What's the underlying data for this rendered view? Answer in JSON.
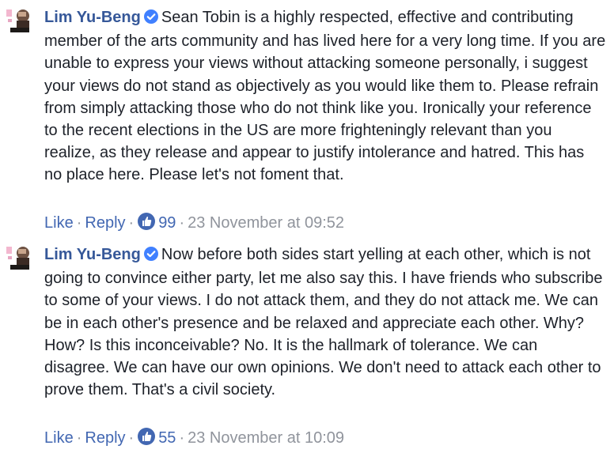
{
  "comments": [
    {
      "author": "Lim Yu-Beng",
      "text": "Sean Tobin is a highly respected, effective and contributing member of the arts community and has lived here for a very long time. If you are unable to express your views without attacking someone personally, i suggest your views do not stand as objectively as you would like them to. Please refrain from simply attacking those who do not think like you. Ironically your reference to the recent elections in the US are more frighteningly relevant than you realize, as they release and appear to justify intolerance and hatred. This has no place here. Please let's not foment that.",
      "like_label": "Like",
      "reply_label": "Reply",
      "reaction_count": "99",
      "timestamp": "23 November at 09:52"
    },
    {
      "author": "Lim Yu-Beng",
      "text": "Now before both sides start yelling at each other, which is not going to convince either party, let me also say this. I have friends who subscribe to some of your views. I do not attack them, and they do not attack me. We can be in each other's presence and be relaxed and appreciate each other. Why? How? Is this inconceivable? No. It is the hallmark of tolerance. We can disagree. We can have our own opinions. We don't need to attack each other to prove them. That's a civil society.",
      "like_label": "Like",
      "reply_label": "Reply",
      "reaction_count": "55",
      "timestamp": "23 November at 10:09"
    }
  ],
  "separator": "·",
  "colors": {
    "author": "#365899",
    "link": "#4267b2",
    "meta": "#90949c",
    "text": "#1d2129",
    "verified_badge": "#4080ff",
    "like_badge": "#4267b2"
  },
  "icons": {
    "verified": "verified-badge-icon",
    "like": "thumbs-up-icon",
    "avatar": "avatar"
  }
}
